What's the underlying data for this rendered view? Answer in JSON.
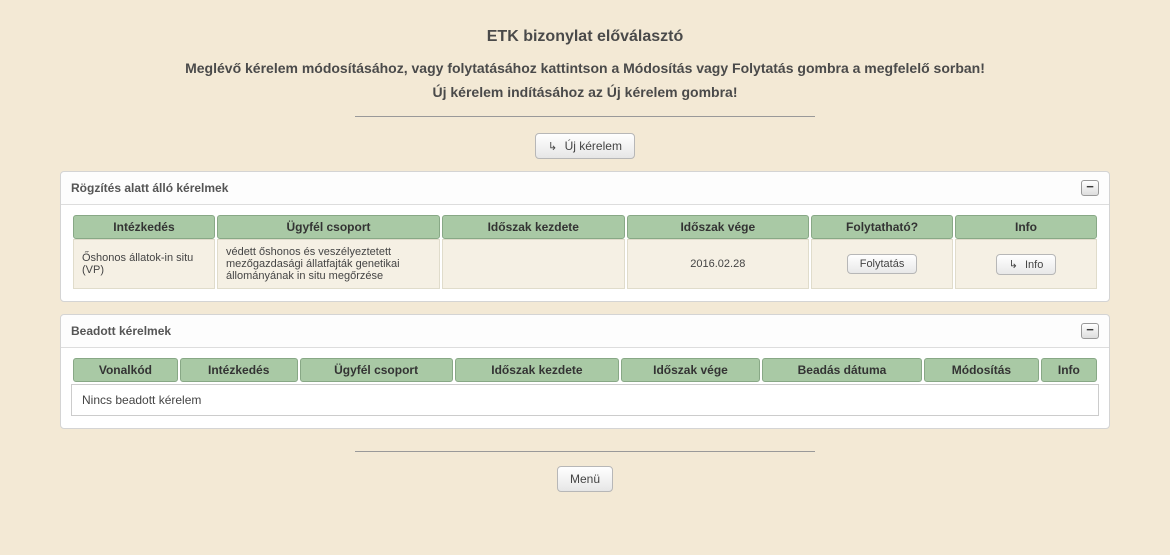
{
  "header": {
    "title": "ETK bizonylat előválasztó",
    "sub1": "Meglévő kérelem módosításához, vagy folytatásához kattintson a Módosítás vagy Folytatás gombra a megfelelő sorban!",
    "sub2": "Új kérelem indításához az Új kérelem gombra!"
  },
  "buttons": {
    "new_request": "Új kérelem",
    "menu": "Menü",
    "continue": "Folytatás",
    "info": "Info"
  },
  "panel1": {
    "title": "Rögzítés alatt álló kérelmek",
    "columns": {
      "c0": "Intézkedés",
      "c1": "Ügyfél csoport",
      "c2": "Időszak kezdete",
      "c3": "Időszak vége",
      "c4": "Folytatható?",
      "c5": "Info"
    },
    "row0": {
      "intezkedes": "Őshonos állatok-in situ (VP)",
      "ugyfel_csoport": "védett őshonos és veszélyeztetett mezőgazdasági állatfajták genetikai állományának in situ megőrzése",
      "idoszak_kezdete": "",
      "idoszak_vege": "2016.02.28"
    }
  },
  "panel2": {
    "title": "Beadott kérelmek",
    "columns": {
      "c0": "Vonalkód",
      "c1": "Intézkedés",
      "c2": "Ügyfél csoport",
      "c3": "Időszak kezdete",
      "c4": "Időszak vége",
      "c5": "Beadás dátuma",
      "c6": "Módosítás",
      "c7": "Info"
    },
    "empty": "Nincs beadott kérelem"
  }
}
